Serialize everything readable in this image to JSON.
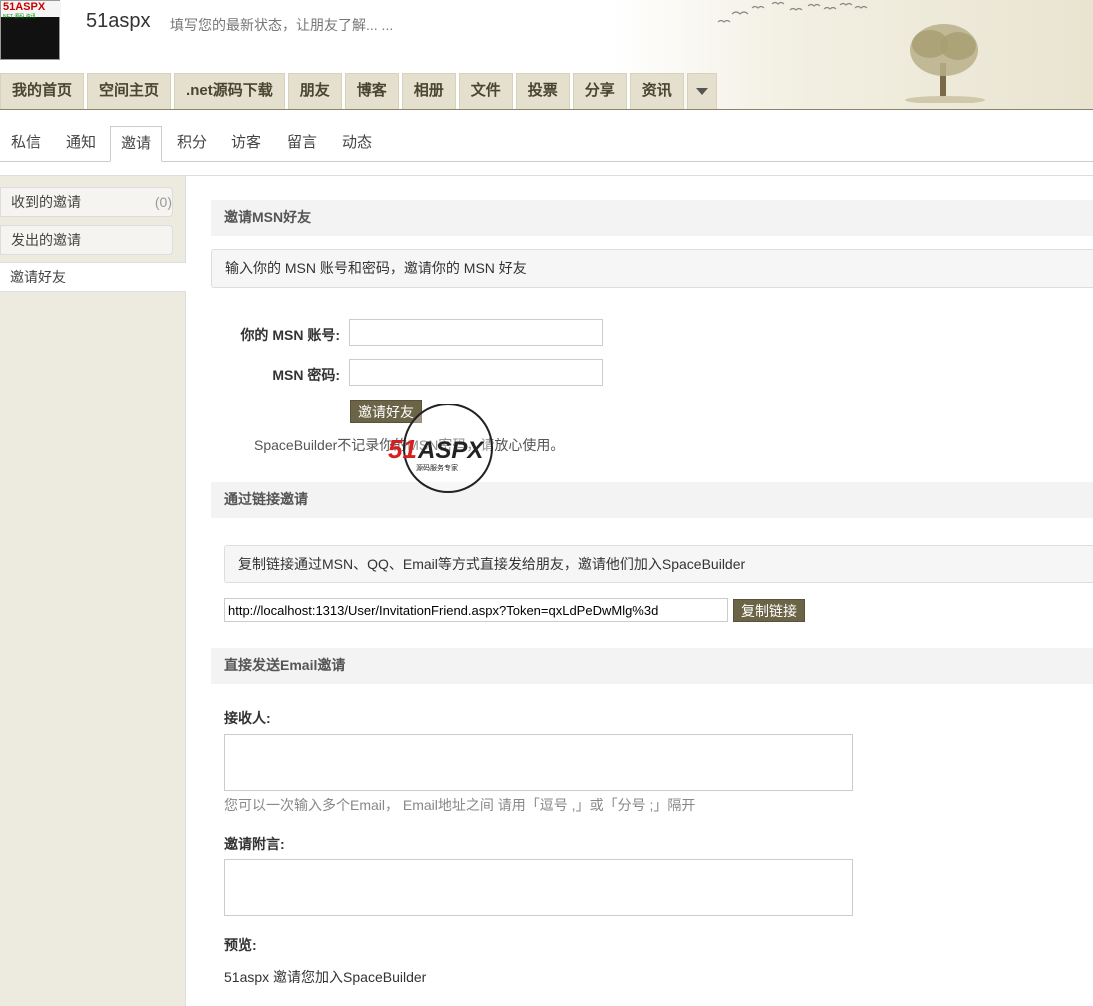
{
  "header": {
    "avatar_logo": "51ASPX",
    "avatar_sub": "NET 源码 资讯",
    "username": "51aspx",
    "status_prompt": "填写您的最新状态，让朋友了解... ..."
  },
  "nav": {
    "items": [
      {
        "label": "我的首页"
      },
      {
        "label": "空间主页"
      },
      {
        "label": ".net源码下载"
      },
      {
        "label": "朋友"
      },
      {
        "label": "博客"
      },
      {
        "label": "相册"
      },
      {
        "label": "文件"
      },
      {
        "label": "投票"
      },
      {
        "label": "分享"
      },
      {
        "label": "资讯"
      }
    ],
    "more_icon": "chevron-down-icon"
  },
  "subnav": {
    "tabs": [
      {
        "label": "私信"
      },
      {
        "label": "通知"
      },
      {
        "label": "邀请",
        "active": true
      },
      {
        "label": "积分"
      },
      {
        "label": "访客"
      },
      {
        "label": "留言"
      },
      {
        "label": "动态"
      }
    ]
  },
  "sidebar": {
    "items": [
      {
        "label": "收到的邀请",
        "count": "(0)"
      },
      {
        "label": "发出的邀请"
      },
      {
        "label": "邀请好友",
        "active": true
      }
    ]
  },
  "msn": {
    "heading": "邀请MSN好友",
    "info": "输入你的 MSN 账号和密码，邀请你的 MSN 好友",
    "account_label": "你的 MSN 账号:",
    "account_value": "",
    "password_label": "MSN 密码:",
    "password_value": "",
    "submit_label": "邀请好友",
    "note": "SpaceBuilder不记录你的MSN密码，请放心使用。"
  },
  "link": {
    "heading": "通过链接邀请",
    "info": "复制链接通过MSN、QQ、Email等方式直接发给朋友，邀请他们加入SpaceBuilder",
    "url": "http://localhost:1313/User/InvitationFriend.aspx?Token=qxLdPeDwMlg%3d",
    "copy_label": "复制链接"
  },
  "email": {
    "heading": "直接发送Email邀请",
    "recipient_label": "接收人:",
    "recipient_hint": "您可以一次输入多个Email，  Email地址之间 请用「逗号 ,」或「分号 ;」隔开",
    "message_label": "邀请附言:",
    "preview_label": "预览:",
    "preview_text": "51aspx 邀请您加入SpaceBuilder"
  },
  "watermark": {
    "brand": "51ASPX",
    "tagline": "源码服务专家"
  },
  "colors": {
    "nav_bg": "#e4e0cd",
    "button_bg": "#6b6447",
    "sidebar_bg": "#edeae0",
    "section_bg": "#f3f3f3"
  }
}
